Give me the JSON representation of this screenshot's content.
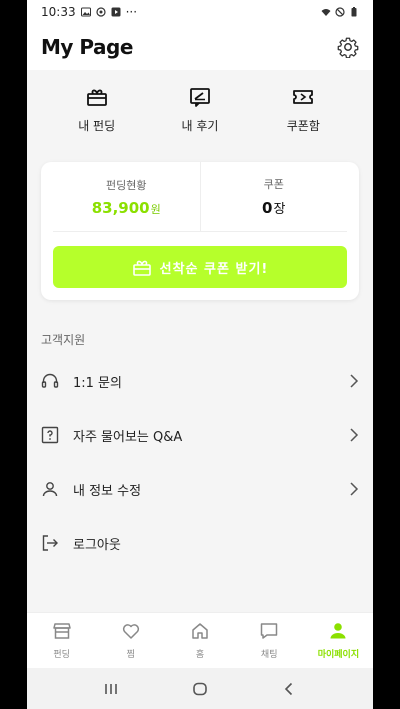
{
  "statusbar": {
    "time": "10:33",
    "dots": "···"
  },
  "header": {
    "title": "My Page"
  },
  "quick_menu": [
    {
      "icon": "gift-box-icon",
      "label": "내 펀딩"
    },
    {
      "icon": "review-icon",
      "label": "내 후기"
    },
    {
      "icon": "ticket-icon",
      "label": "쿠폰함"
    }
  ],
  "funding": {
    "status_label": "펀딩현황",
    "amount": "83,900",
    "amount_unit": "원",
    "coupon_label": "쿠폰",
    "coupon_count": "0",
    "coupon_unit": "장",
    "button_label": "선착순 쿠폰 받기!"
  },
  "support": {
    "title": "고객지원",
    "items": [
      {
        "icon": "headset-icon",
        "label": "1:1 문의"
      },
      {
        "icon": "faq-icon",
        "label": "자주 물어보는 Q&A"
      },
      {
        "icon": "person-icon",
        "label": "내 정보 수정"
      },
      {
        "icon": "logout-icon",
        "label": "로그아웃"
      }
    ]
  },
  "bottom_nav": [
    {
      "icon": "store-icon",
      "label": "펀딩"
    },
    {
      "icon": "heart-icon",
      "label": "찜"
    },
    {
      "icon": "home-icon",
      "label": "홈"
    },
    {
      "icon": "chat-icon",
      "label": "채팅"
    },
    {
      "icon": "person-icon",
      "label": "마이페이지"
    }
  ],
  "accent_color": "#b6ff2b"
}
